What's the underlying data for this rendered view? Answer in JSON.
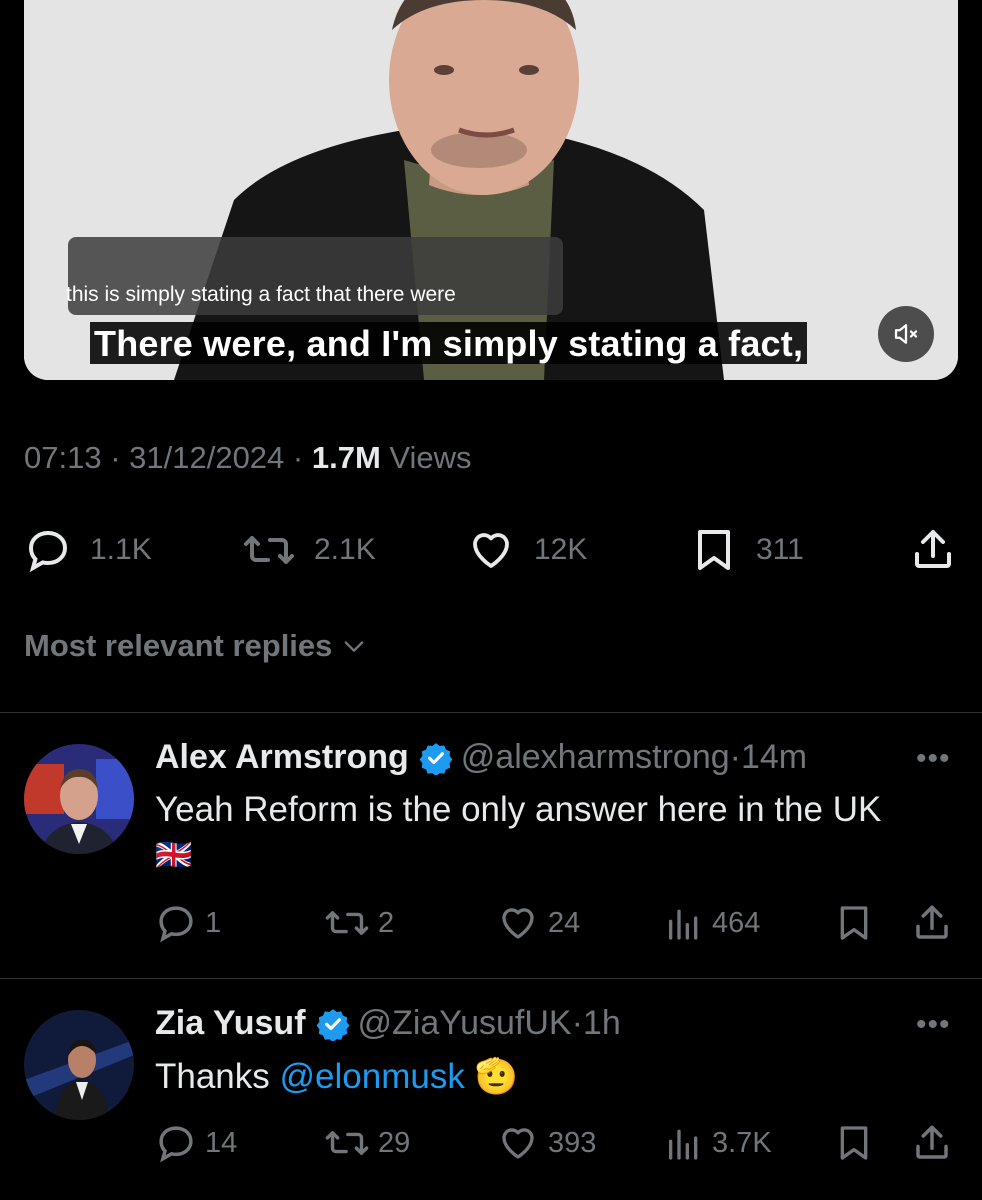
{
  "video": {
    "auto_caption": "this is simply stating a fact that there were",
    "burned_subtitle": "There were, and I'm simply stating a fact,",
    "mute_icon": "speaker-muted-icon"
  },
  "tweet": {
    "time": "07:13",
    "date": "31/12/2024",
    "views_count": "1.7M",
    "views_label": "Views",
    "replies": "1.1K",
    "reposts": "2.1K",
    "likes": "12K",
    "bookmarks": "311"
  },
  "sort_label": "Most relevant replies",
  "replies": [
    {
      "name": "Alex Armstrong",
      "handle": "@alexharmstrong",
      "time": "14m",
      "text": "Yeah Reform is the only answer here in the UK",
      "emoji": "🇬🇧",
      "stats": {
        "replies": "1",
        "reposts": "2",
        "likes": "24",
        "views": "464"
      }
    },
    {
      "name": "Zia Yusuf",
      "handle": "@ZiaYusufUK",
      "time": "1h",
      "text_prefix": "Thanks ",
      "mention": "@elonmusk",
      "emoji": "🫡",
      "stats": {
        "replies": "14",
        "reposts": "29",
        "likes": "393",
        "views": "3.7K"
      }
    }
  ],
  "colors": {
    "background": "#000000",
    "text": "#e7e9ea",
    "muted": "#71767b",
    "link": "#1d9bf0",
    "verified": "#1d9bf0",
    "divider": "#2f3336"
  }
}
